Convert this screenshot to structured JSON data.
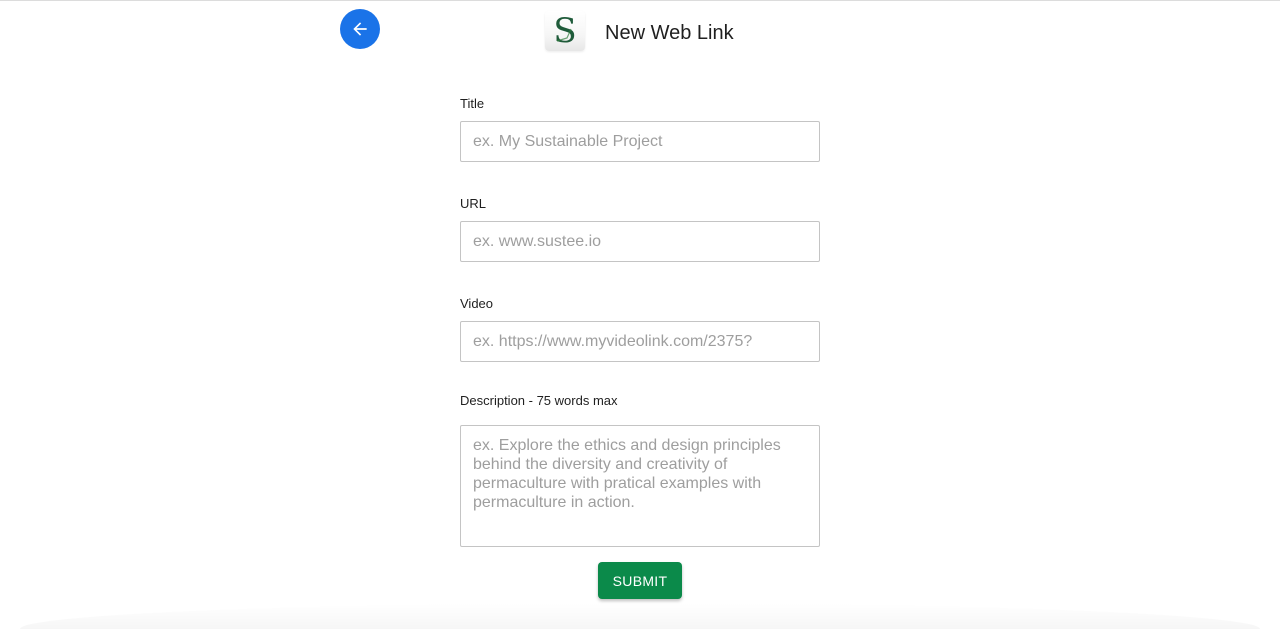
{
  "header": {
    "title": "New Web Link",
    "back_icon": "arrow-left-icon",
    "logo_letter": "S",
    "accent_color": "#1a73e8"
  },
  "form": {
    "title": {
      "label": "Title",
      "value": "",
      "placeholder": "ex. My Sustainable Project"
    },
    "url": {
      "label": "URL",
      "value": "",
      "placeholder": "ex. www.sustee.io"
    },
    "video": {
      "label": "Video",
      "value": "",
      "placeholder": "ex. https://www.myvideolink.com/2375?"
    },
    "description": {
      "label": "Description - 75 words max",
      "value": "",
      "placeholder": "ex. Explore the ethics and design principles behind the diversity and creativity of permaculture with pratical examples with permaculture in action."
    },
    "submit_label": "SUBMIT",
    "submit_color": "#0b8a4a"
  }
}
